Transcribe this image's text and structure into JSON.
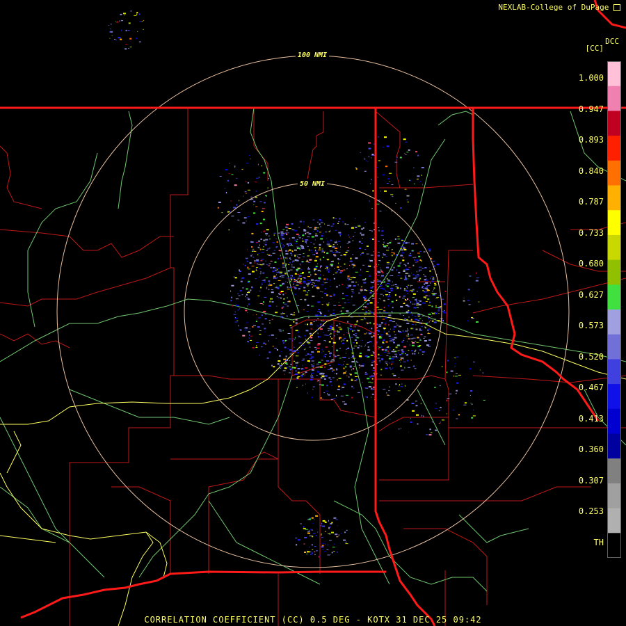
{
  "header": {
    "credit": "NEXLAB-College of DuPage",
    "credit_icon": "external-link-icon",
    "corner_code": "DCC",
    "unit_label": "[CC]"
  },
  "map": {
    "range_rings": [
      {
        "label": "100 NMI"
      },
      {
        "label": "50 NMI"
      }
    ],
    "colors": {
      "state_border": "#ff1a1a",
      "county_border": "#cc1a1a",
      "highway": "#ffff66",
      "river": "#80d080",
      "range_ring": "#e8c0a0"
    }
  },
  "colorbar": {
    "tick_labels": [
      "1.000",
      "0.947",
      "0.893",
      "0.840",
      "0.787",
      "0.733",
      "0.680",
      "0.627",
      "0.573",
      "0.520",
      "0.467",
      "0.413",
      "0.360",
      "0.307",
      "0.253",
      "TH"
    ],
    "stops": [
      "#ffc0d8",
      "#f080b0",
      "#c00020",
      "#ff2000",
      "#ff7000",
      "#ffb000",
      "#ffff00",
      "#c8d800",
      "#90c000",
      "#40e040",
      "#a0a0e0",
      "#7070d8",
      "#4040e0",
      "#1010e8",
      "#0000d0",
      "#0000a0",
      "#808080",
      "#a0a0a0",
      "#b0b0b0",
      "#000000"
    ]
  },
  "footer": {
    "product": "CORRELATION COEFFICIENT (CC) 0.5 DEG - KOTX 31 DEC 25 09:42"
  }
}
